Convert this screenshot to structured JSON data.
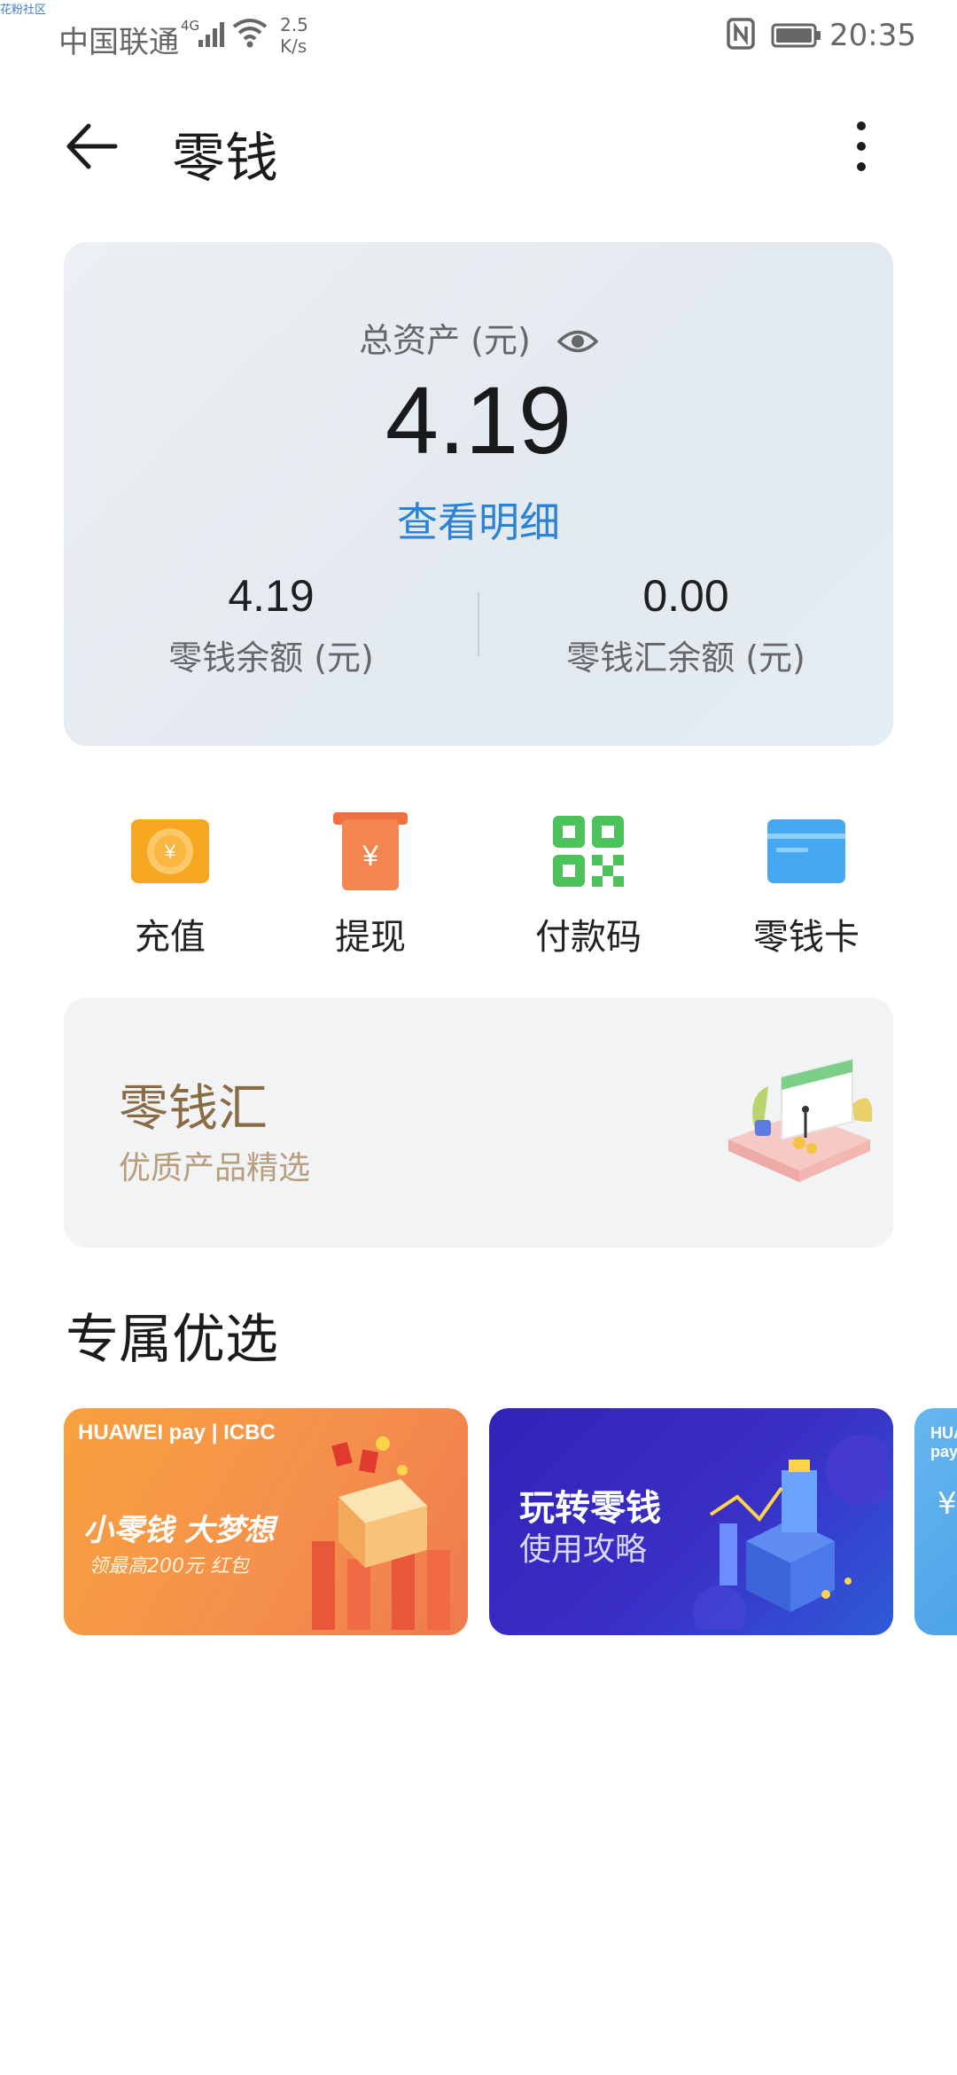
{
  "watermark": "花粉社区",
  "status_bar": {
    "carrier": "中国联通",
    "network": "4G",
    "speed_value": "2.5",
    "speed_unit": "K/s",
    "time": "20:35"
  },
  "header": {
    "title": "零钱"
  },
  "asset_card": {
    "total_label": "总资产 (元)",
    "total_value": "4.19",
    "detail_link": "查看明细",
    "balance_value": "4.19",
    "balance_label": "零钱余额 (元)",
    "hui_value": "0.00",
    "hui_label": "零钱汇余额 (元)"
  },
  "quick_actions": [
    {
      "label": "充值",
      "icon": "recharge-coin-icon"
    },
    {
      "label": "提现",
      "icon": "withdraw-icon"
    },
    {
      "label": "付款码",
      "icon": "qr-code-icon"
    },
    {
      "label": "零钱卡",
      "icon": "card-icon"
    }
  ],
  "lingqianhui": {
    "title": "零钱汇",
    "subtitle": "优质产品精选"
  },
  "featured": {
    "section_title": "专属优选",
    "banners": [
      {
        "brand": "HUAWEI pay | ICBC",
        "title": "小零钱 大梦想",
        "subtitle": "领最高200元 红包"
      },
      {
        "title": "玩转零钱",
        "subtitle": "使用攻略"
      },
      {
        "brand": "HUAWEI pay",
        "title": "¥"
      }
    ]
  },
  "colors": {
    "accent_blue": "#2b83d6",
    "gold_text": "#8a6b43",
    "recharge_orange": "#f7a61f",
    "withdraw_orange": "#f0703f",
    "qr_green": "#4cc25b",
    "card_blue": "#45a8f0"
  }
}
